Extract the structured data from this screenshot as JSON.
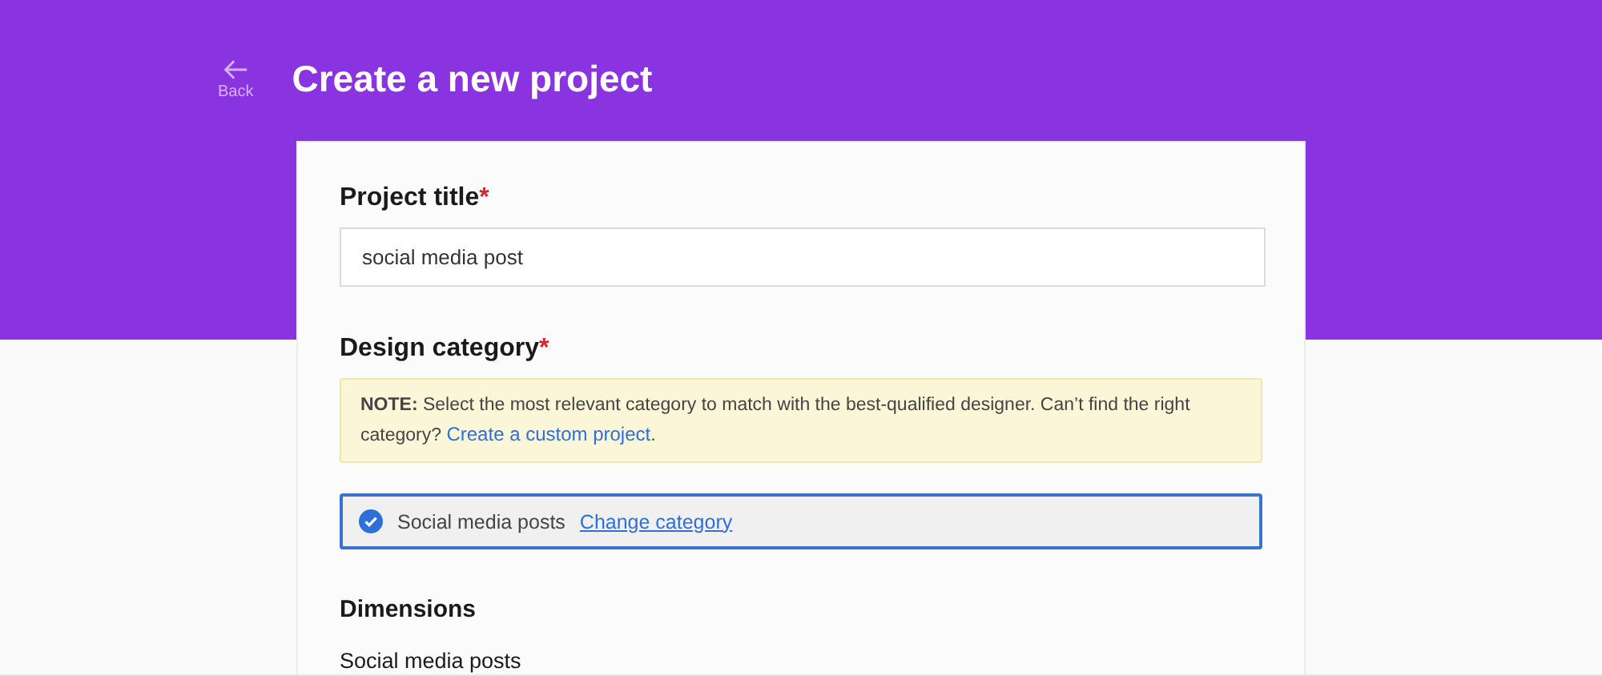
{
  "header": {
    "back_label": "Back",
    "title": "Create a new project"
  },
  "project_title": {
    "label": "Project title",
    "required_mark": "*",
    "value": "social media post"
  },
  "design_category": {
    "label": "Design category",
    "required_mark": "*",
    "note": {
      "text": "**NOTE:** Select the most relevant category to match with the best-qualified designer. Can’t find the right category?",
      "link": "Create a custom project",
      "end": "."
    },
    "selected_category": {
      "label": "Social media posts",
      "checked": true,
      "change_link": "Change category"
    }
  },
  "dimensions": {
    "heading": "Dimensions",
    "subheading": "Social media posts"
  }
}
